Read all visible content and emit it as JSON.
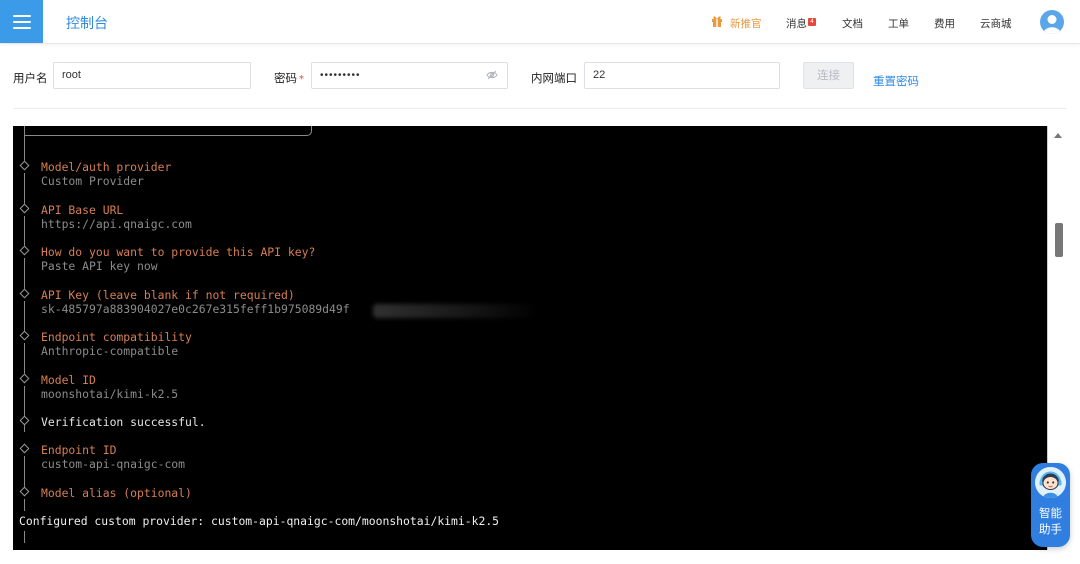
{
  "header": {
    "title": "控制台",
    "nav": {
      "promo": "新推官",
      "messages": "消息",
      "messages_badge": "4",
      "docs": "文档",
      "tickets": "工单",
      "billing": "费用",
      "marketplace": "云商城"
    }
  },
  "form": {
    "username_label": "用户名",
    "username_value": "root",
    "password_label": "密码",
    "password_required": "*",
    "password_value": "•••••••••",
    "port_label": "内网端口",
    "port_value": "22",
    "connect_label": "连接",
    "reset_label": "重置密码"
  },
  "terminal": {
    "blocks": [
      {
        "question": "Model/auth provider",
        "answer": "Custom Provider"
      },
      {
        "question": "API Base URL",
        "answer": "https://api.qnaigc.com"
      },
      {
        "question": "How do you want to provide this API key?",
        "answer": "Paste API key now"
      },
      {
        "question": "API Key (leave blank if not required)",
        "answer": "sk-485797a883904027e0c267e315feff1b975089d49f"
      },
      {
        "question": "Endpoint compatibility",
        "answer": "Anthropic-compatible"
      },
      {
        "question": "Model ID",
        "answer": "moonshotai/kimi-k2.5"
      },
      {
        "status": "Verification successful."
      },
      {
        "question": "Endpoint ID",
        "answer": "custom-api-qnaigc-com"
      },
      {
        "question": "Model alias (optional)",
        "answer": ""
      }
    ],
    "final_line": "Configured custom provider: custom-api-qnaigc-com/moonshotai/kimi-k2.5"
  },
  "assistant": {
    "line1": "智能",
    "line2": "助手"
  },
  "colors": {
    "accent": "#2f8ae0",
    "promo": "#e89a3c",
    "terminal_bg": "#000000",
    "prompt_orange": "#d67e52",
    "answer_gray": "#8c8c8c"
  }
}
